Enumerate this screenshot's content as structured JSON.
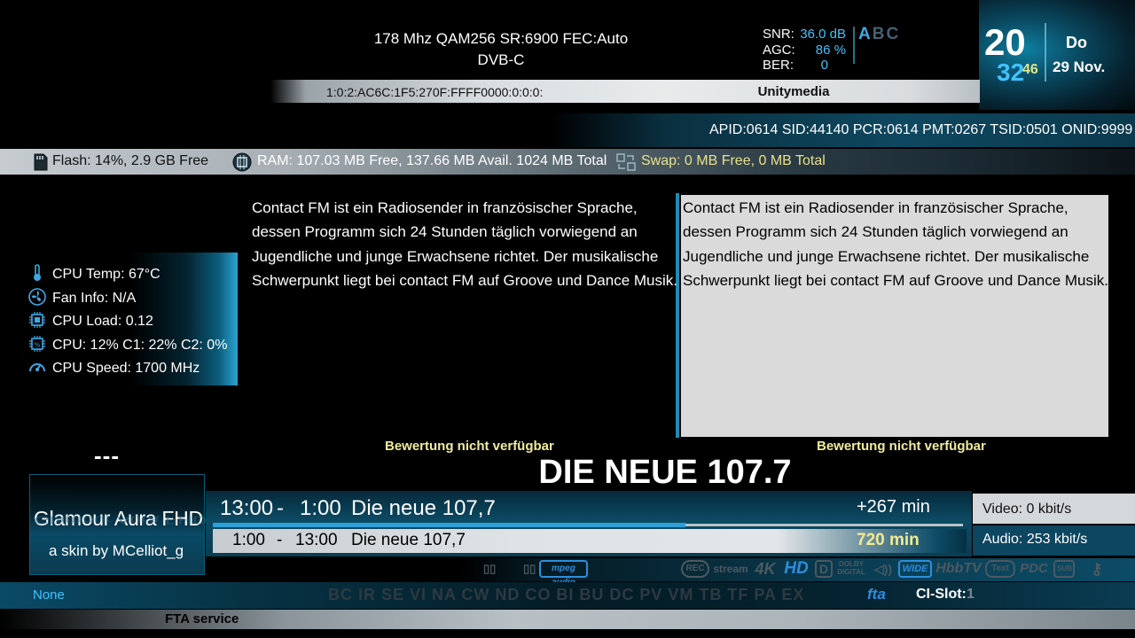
{
  "tuner": {
    "line1": "178 Mhz  QAM256  SR:6900  FEC:Auto",
    "line2": "DVB-C"
  },
  "signal": {
    "snr_label": "SNR:",
    "snr_value": "36.0 dB",
    "agc_label": "AGC:",
    "agc_value": "86 %",
    "ber_label": "BER:",
    "ber_value": "0",
    "abc_a": "A",
    "abc_b": "B",
    "abc_c": "C"
  },
  "clock": {
    "hour": "20",
    "minute": "32",
    "second": "46",
    "day": "Do",
    "date": "29 Nov."
  },
  "service_ref": "1:0:2:AC6C:1F5:270F:FFFF0000:0:0:0:",
  "provider": "Unitymedia",
  "pids": "APID:0614 SID:44140 PCR:0614 PMT:0267 TSID:0501 ONID:9999",
  "memory": {
    "flash": "Flash: 14%, 2.9 GB Free",
    "ram": "RAM: 107.03 MB Free, 137.66 MB Avail. 1024 MB Total",
    "swap": "Swap: 0 MB Free, 0 MB Total",
    "flash_icon": "sd-card-icon",
    "ram_icon": "memory-chip-icon",
    "swap_icon": "swap-icon"
  },
  "system": {
    "cpu_temp": "CPU Temp: 67°C",
    "fan_info": "Fan Info: N/A",
    "cpu_load": "CPU Load: 0.12",
    "cpu_usage": "CPU: 12% C1: 22% C2:  0%",
    "cpu_speed": "CPU Speed: 1700 MHz",
    "dash": "---"
  },
  "description": {
    "left": "Contact FM ist ein Radiosender in französischer Sprache, dessen Programm sich 24 Stunden täglich vorwiegend an Jugendliche und junge Erwachsene richtet. Der musikalische Schwerpunkt liegt bei contact FM auf Groove und Dance Musik.",
    "right": "Contact FM ist ein Radiosender in französischer Sprache, dessen Programm sich 24 Stunden täglich vorwiegend an Jugendliche und junge Erwachsene richtet. Der musikalische Schwerpunkt liegt bei contact FM auf Groove und Dance Musik.",
    "rating_left": "Bewertung nicht verfügbar",
    "rating_right": "Bewertung nicht verfügbar"
  },
  "channel_name": "DIE NEUE 107.7",
  "epg": {
    "now": {
      "start": "13:00",
      "sep": "-",
      "end": "1:00",
      "title": "Die neue 107,7",
      "remaining": "+267 min",
      "progress": 0.63
    },
    "next": {
      "start": "1:00",
      "sep": "-",
      "end": "13:00",
      "title": "Die neue 107,7",
      "duration": "720 min"
    }
  },
  "bitrate": {
    "video": "Video:   0 kbit/s",
    "audio": "Audio:   253 kbit/s"
  },
  "skin": {
    "title": "Glamour Aura FHD",
    "subtitle": "a skin by MCelliot_g"
  },
  "icons": {
    "film1": "▯▯",
    "film2": "▯▯",
    "mpeg": "mpeg audio",
    "rec": "REC",
    "stream": "stream",
    "k4": "4K",
    "hd": "HD",
    "dolby_d": "D",
    "dolby": "DOLBY DIGITAL",
    "speaker": "◁))",
    "wide": "WIDE",
    "hbbtv": "HbbTV",
    "text": "Text",
    "pdc": "PDC",
    "sub": "SUB",
    "key": "⚷"
  },
  "ca_bar": {
    "none": "None",
    "systems": "BC IR SE VI NA CW ND CO BI BU DC PV VM TB TF PA EX",
    "fta_logo": "fta",
    "ci_label": "CI-Slot:",
    "ci_value": "1"
  },
  "fta_service": "FTA service",
  "colors": {
    "accent": "#3fc3ff",
    "rating": "#f1ec9c",
    "swap": "#e8e18a"
  }
}
